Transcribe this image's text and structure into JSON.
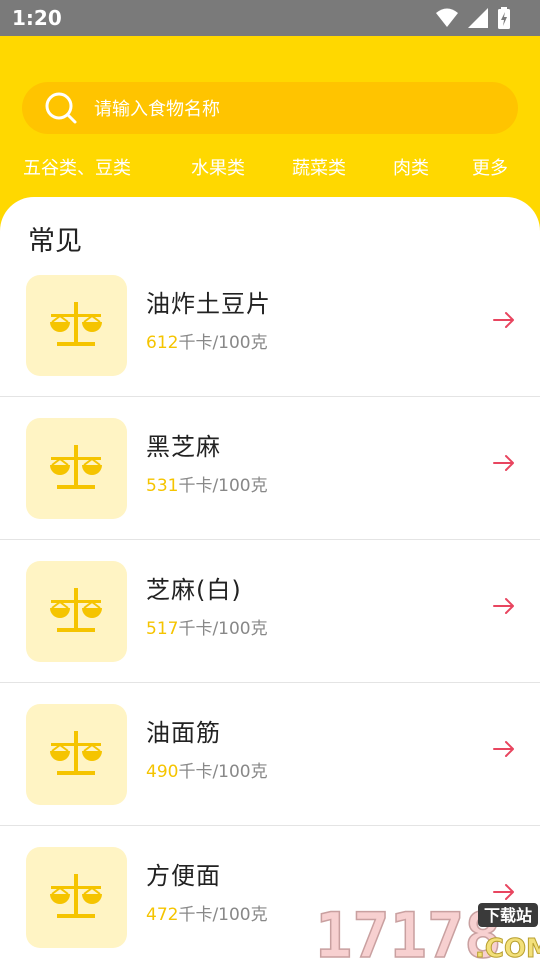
{
  "status": {
    "time": "1:20"
  },
  "search": {
    "placeholder": "请输入食物名称"
  },
  "tabs": [
    "五谷类、豆类",
    "水果类",
    "蔬菜类",
    "肉类",
    "更多"
  ],
  "section_title": "常见",
  "foods": [
    {
      "name": "油炸土豆片",
      "kcal": "612",
      "unit": "千卡/100克"
    },
    {
      "name": "黑芝麻",
      "kcal": "531",
      "unit": "千卡/100克"
    },
    {
      "name": "芝麻(白)",
      "kcal": "517",
      "unit": "千卡/100克"
    },
    {
      "name": "油面筋",
      "kcal": "490",
      "unit": "千卡/100克"
    },
    {
      "name": "方便面",
      "kcal": "472",
      "unit": "千卡/100克"
    }
  ],
  "watermark": {
    "number": "17178",
    "badge": "下载站",
    "domain": ".COM"
  },
  "colors": {
    "header": "#ffd800",
    "search_bg": "#ffc400",
    "accent_number": "#f5c400",
    "arrow": "#e8455f",
    "thumb_bg": "#fff4c4"
  },
  "icons": {
    "search": "search-icon",
    "food": "balance-scale-icon",
    "row_action": "arrow-right-icon"
  }
}
